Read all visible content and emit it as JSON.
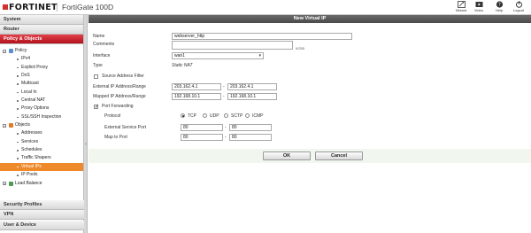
{
  "header": {
    "brand": "FORTINET",
    "device": "FortiGate 100D",
    "buttons": [
      {
        "label": "Wizard",
        "icon": "wizard-icon"
      },
      {
        "label": "Video",
        "icon": "video-icon"
      },
      {
        "label": "Help",
        "icon": "help-icon"
      },
      {
        "label": "Logout",
        "icon": "logout-icon"
      }
    ]
  },
  "sidebar": {
    "sections_top": [
      "System",
      "Router",
      "Policy & Objects"
    ],
    "active_section": "Policy & Objects",
    "tree": {
      "policy": "Policy",
      "policy_items": [
        "IPv4",
        "Explicit Proxy",
        "DoS",
        "Multicast",
        "Local In",
        "Central NAT",
        "Proxy Options",
        "SSL/SSH Inspection"
      ],
      "objects": "Objects",
      "objects_items": [
        "Addresses",
        "Services",
        "Schedules",
        "Traffic Shapers",
        "Virtual IPs",
        "IP Pools"
      ],
      "selected": "Virtual IPs",
      "load_balance": "Load Balance"
    },
    "sections_bottom": [
      "Security Profiles",
      "VPN",
      "User & Device"
    ]
  },
  "dialog": {
    "title": "New Virtual IP",
    "name_label": "Name",
    "name_value": "webserver_http",
    "comments_label": "Comments",
    "comments_counter": "0/255",
    "interface_label": "Interface",
    "interface_value": "wan1",
    "type_label": "Type",
    "type_value": "Static NAT",
    "source_filter_label": "Source Address Filter",
    "source_filter_checked": false,
    "ext_ip_label": "External IP Address/Range",
    "ext_ip_start": "203.162.4.1",
    "ext_ip_end": "203.162.4.1",
    "mapped_ip_label": "Mapped IP Address/Range",
    "mapped_ip_start": "192.168.10.1",
    "mapped_ip_end": "192.168.10.1",
    "port_forwarding_label": "Port Forwarding",
    "port_forwarding_checked": true,
    "protocol_label": "Protocol",
    "protocols": [
      "TCP",
      "UDP",
      "SCTP",
      "ICMP"
    ],
    "protocol_selected": "TCP",
    "ext_port_label": "External Service Port",
    "ext_port_start": "80",
    "ext_port_end": "80",
    "map_port_label": "Map to Port",
    "map_port_start": "80",
    "map_port_end": "80",
    "ok_label": "OK",
    "cancel_label": "Cancel"
  },
  "colors": {
    "brand_red": "#d32f2f",
    "active_section": "#c0202a",
    "selected_item": "#ef8a2a",
    "dialog_title": "#555555",
    "button_bar": "#f1f6ee"
  }
}
